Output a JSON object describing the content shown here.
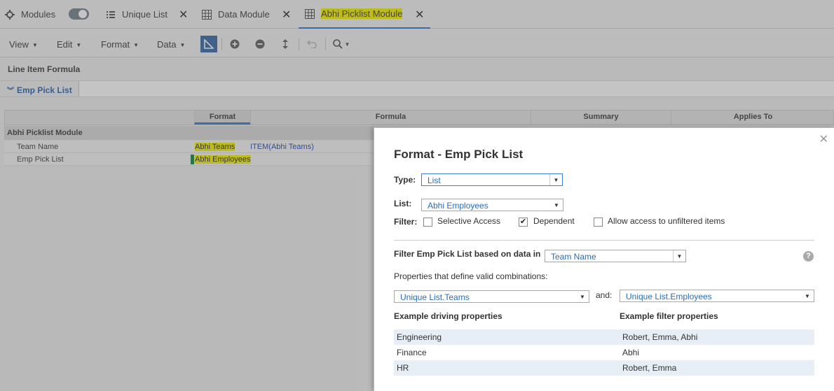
{
  "tabs": {
    "modules": "Modules",
    "unique_list": "Unique List",
    "data_module": "Data Module",
    "picklist_module": "Abhi Picklist Module"
  },
  "toolbar": {
    "view": "View",
    "edit": "Edit",
    "format": "Format",
    "data": "Data"
  },
  "formula": {
    "section_title": "Line Item Formula",
    "item_name": "Emp Pick List"
  },
  "grid": {
    "headers": [
      "Format",
      "Formula",
      "Summary",
      "Applies To"
    ],
    "section": "Abhi Picklist Module",
    "rows": [
      {
        "label": "Team Name",
        "format": "Abhi Teams",
        "formula": "ITEM(Abhi Teams)"
      },
      {
        "label": "Emp Pick List",
        "format": "Abhi Employees",
        "formula": ""
      }
    ]
  },
  "dialog": {
    "title": "Format - Emp Pick List",
    "type_label": "Type:",
    "type_value": "List",
    "list_label": "List:",
    "list_value": "Abhi Employees",
    "filter_label": "Filter:",
    "filter_options": {
      "selective_access": "Selective Access",
      "dependent": "Dependent",
      "allow_unfiltered": "Allow access to unfiltered items"
    },
    "filter_checked": {
      "selective_access": false,
      "dependent": true,
      "allow_unfiltered": false
    },
    "filter_based_label": "Filter Emp Pick List based on data in",
    "filter_based_value": "Team Name",
    "properties_label": "Properties that define valid combinations:",
    "property_a": "Unique List.Teams",
    "and_label": "and:",
    "property_b": "Unique List.Employees",
    "example_driving_header": "Example driving properties",
    "example_filter_header": "Example filter properties",
    "examples": [
      {
        "driving": "Engineering",
        "filter": "Robert, Emma, Abhi"
      },
      {
        "driving": "Finance",
        "filter": "Abhi"
      },
      {
        "driving": "HR",
        "filter": "Robert, Emma"
      }
    ]
  },
  "colors": {
    "accent": "#3b7fd6",
    "highlight": "#f5f20a",
    "link": "#2a6cb8"
  }
}
